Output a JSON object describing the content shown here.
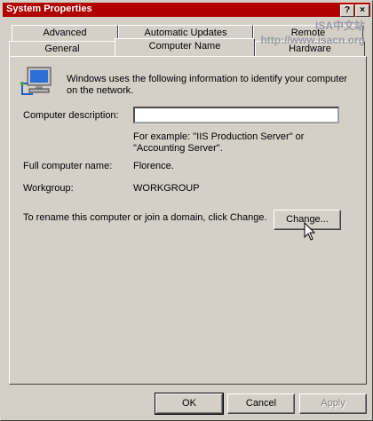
{
  "window": {
    "title": "System Properties",
    "help_glyph": "?",
    "close_glyph": "×"
  },
  "watermark": {
    "line1": "ISA中文站",
    "line2": "http://www.isacn.org"
  },
  "tabs": {
    "row1": [
      {
        "label": "Advanced"
      },
      {
        "label": "Automatic Updates"
      },
      {
        "label": "Remote"
      }
    ],
    "row2": [
      {
        "label": "General"
      },
      {
        "label": "Computer Name",
        "active": true
      },
      {
        "label": "Hardware"
      }
    ]
  },
  "content": {
    "intro": "Windows uses the following information to identify your computer on the network.",
    "computer_description_label": "Computer description:",
    "computer_description_value": "",
    "example_text_line1": "For example: \"IIS Production Server\" or",
    "example_text_line2": "\"Accounting Server\".",
    "full_name_label": "Full computer name:",
    "full_name_value": "Florence.",
    "workgroup_label": "Workgroup:",
    "workgroup_value": "WORKGROUP",
    "rename_text": "To rename this computer or join a domain, click Change.",
    "change_button": "Change..."
  },
  "footer": {
    "ok": "OK",
    "cancel": "Cancel",
    "apply": "Apply"
  },
  "icons": {
    "computer": "computer-network-icon",
    "cursor": "mouse-cursor-icon"
  },
  "colors": {
    "titlebar": "#b00000",
    "face": "#d4d0c8"
  }
}
